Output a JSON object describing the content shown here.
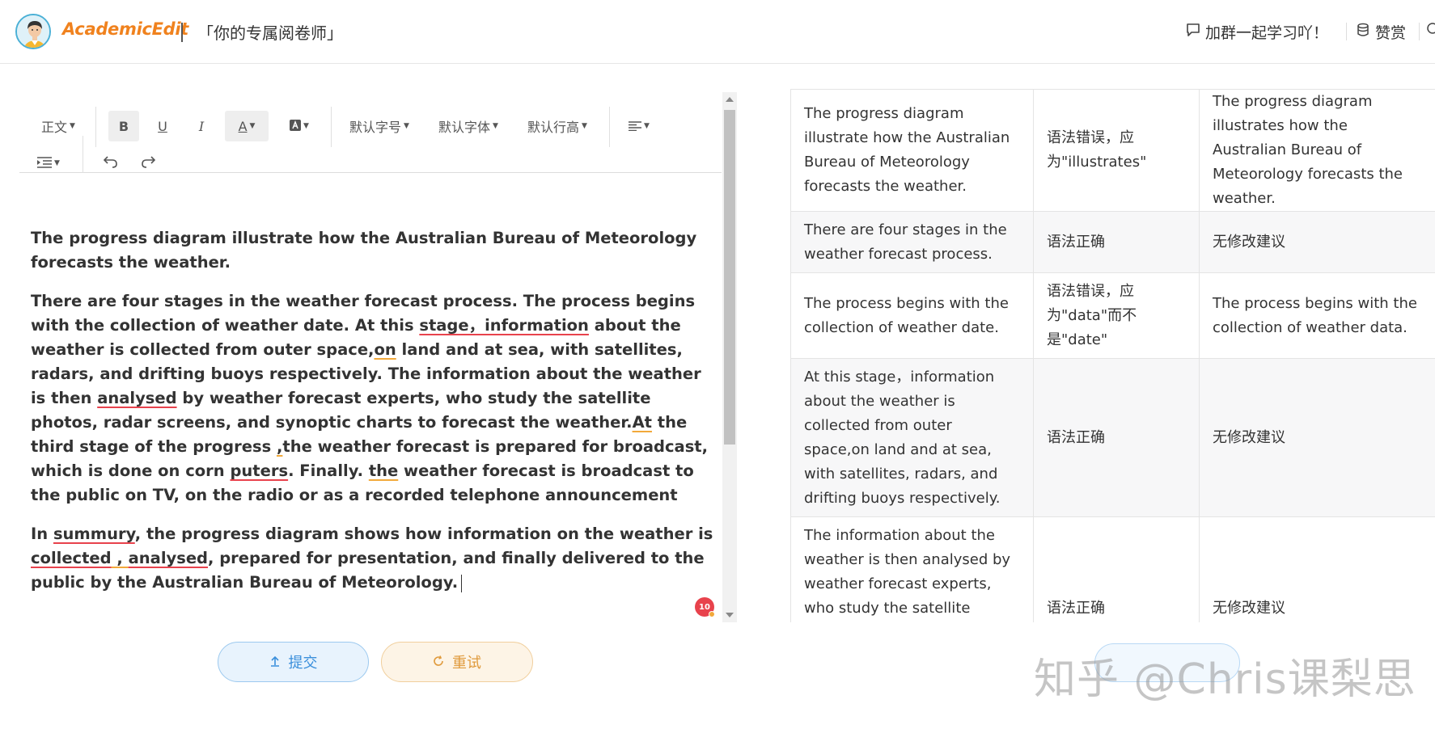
{
  "header": {
    "brand": "AcademicEdit",
    "slogan": "「你的专属阅卷师」",
    "links": [
      {
        "label": "加群一起学习吖！",
        "icon": "chat-icon"
      },
      {
        "label": "赞赏",
        "icon": "coins-icon"
      }
    ]
  },
  "toolbar": {
    "paragraph_style": "正文",
    "bold": "B",
    "underline": "U",
    "italic": "I",
    "font_color": "A",
    "font_size": "默认字号",
    "font_family": "默认字体",
    "line_height": "默认行高"
  },
  "document": {
    "paragraphs": [
      {
        "segments": [
          {
            "text": "The progress diagram illustrate how the Australian Bureau of Meteorology forecasts the weather."
          }
        ]
      },
      {
        "segments": [
          {
            "text": "There are four stages in the weather forecast process. The process begins with the collection of weather date. At this "
          },
          {
            "text": "stage，information",
            "mark": "r"
          },
          {
            "text": " about the weather is collected from outer space,"
          },
          {
            "text": "on",
            "mark": "y"
          },
          {
            "text": " land and at sea, with satellites, radars, and drifting buoys respectively. The information about the weather is then "
          },
          {
            "text": "analysed",
            "mark": "r"
          },
          {
            "text": " by weather forecast experts, who study the satellite photos, radar screens, and synoptic charts to forecast the weather."
          },
          {
            "text": "At",
            "mark": "y"
          },
          {
            "text": " the third stage of the progress "
          },
          {
            "text": ",",
            "mark": "y"
          },
          {
            "text": "the weather forecast is prepared for broadcast, which is done on corn "
          },
          {
            "text": "puters",
            "mark": "r"
          },
          {
            "text": ". Finally. "
          },
          {
            "text": "the",
            "mark": "y"
          },
          {
            "text": " weather forecast is broadcast to the public on TV, on the radio or as a recorded telephone announcement"
          }
        ]
      },
      {
        "segments": [
          {
            "text": "In "
          },
          {
            "text": "summury",
            "mark": "r"
          },
          {
            "text": ", the progress diagram shows how information on the weather is "
          },
          {
            "text": "collected",
            "mark": "r"
          },
          {
            "text": " , ",
            "mark": "y"
          },
          {
            "text": "analysed",
            "mark": "r"
          },
          {
            "text": ", prepared for presentation, and finally delivered to the public by the Australian Bureau of Meteorology."
          }
        ]
      }
    ],
    "error_count": "10"
  },
  "buttons": {
    "submit": "提交",
    "reset": "重试"
  },
  "results_table": {
    "rows": [
      {
        "original": "The progress diagram illustrate how the Australian Bureau of Meteorology forecasts the weather.",
        "verdict": "语法错误，应为\"illustrates\"",
        "suggestion": "The progress diagram illustrates how the Australian Bureau of Meteorology forecasts the weather."
      },
      {
        "original": "There are four stages in the weather forecast process.",
        "verdict": "语法正确",
        "suggestion": "无修改建议"
      },
      {
        "original": "The process begins with the collection of weather date.",
        "verdict": "语法错误，应为\"data\"而不是\"date\"",
        "suggestion": "The process begins with the collection of weather data."
      },
      {
        "original": "At this stage，information about the weather is collected from outer space,on land and at sea, with satellites, radars, and drifting buoys respectively.",
        "verdict": "语法正确",
        "suggestion": "无修改建议"
      },
      {
        "original": "The information about the weather is then analysed by weather forecast experts, who study the satellite photos, radar screens, and synoptic charts to forecast the weather.",
        "verdict": "语法正确",
        "suggestion": "无修改建议"
      }
    ]
  },
  "watermark": "知乎 @Chris课梨思"
}
